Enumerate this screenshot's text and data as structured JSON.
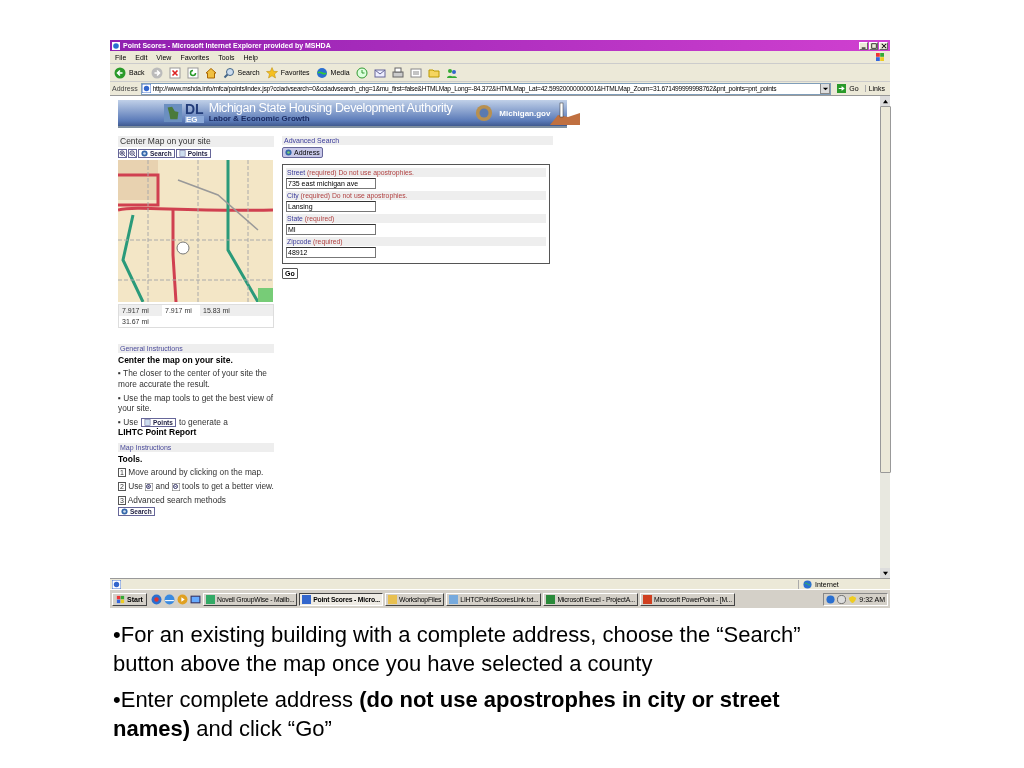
{
  "window": {
    "title": "Point Scores - Microsoft Internet Explorer provided by MSHDA"
  },
  "menu": [
    "File",
    "Edit",
    "View",
    "Favorites",
    "Tools",
    "Help"
  ],
  "toolbar": {
    "back": "Back",
    "search": "Search",
    "favorites": "Favorites",
    "media": "Media"
  },
  "address": {
    "label": "Address",
    "url": "http://www.mshda.info/mfca/points/index.jsp?cciadvsearch=0&cciadvsearch_chg=1&mu_first=false&HTMLMap_Long=-84.372&HTMLMap_Lat=42.59920000000001&HTMLMap_Zoom=31.671499999998762&pnt_points=pnt_points",
    "go": "Go",
    "links": "Links"
  },
  "banner": {
    "logo_top": "DL",
    "logo_bottom": "EG",
    "title": "Michigan State Housing Development Authority",
    "subtitle": "Labor & Economic Growth",
    "site": "Michigan.gov"
  },
  "map_panel": {
    "heading": "Center Map on your site",
    "search_button": "Search",
    "points_button": "Points",
    "scales": [
      "7.917 mi",
      "7.917 mi",
      "15.83 mi",
      "31.67 mi"
    ]
  },
  "general": {
    "heading": "General Instructions",
    "title": "Center the map on your site.",
    "bullets": [
      "▪ The closer to the center of your site the more accurate the result.",
      "▪ Use the map tools to get the best view of your site."
    ],
    "points_before": "▪ Use",
    "points_button": "Points",
    "points_after": "to generate a",
    "report": "LIHTC Point Report"
  },
  "map_instructions": {
    "heading": "Map Instructions",
    "title": "Tools.",
    "steps": [
      {
        "kind": "text",
        "number": "1",
        "text": "Move around by clicking on the map."
      },
      {
        "kind": "zoom",
        "number": "2",
        "before": "Use",
        "middle": "and",
        "after": "tools to get a better view."
      },
      {
        "kind": "search",
        "number": "3",
        "text": "Advanced search methods",
        "button": "Search"
      }
    ]
  },
  "search_panel": {
    "heading": "Advanced Search",
    "address_button": "Address",
    "go": "Go",
    "fields": [
      {
        "label": "Street",
        "note": "(required) Do not use apostrophies.",
        "value": "735 east michigan ave"
      },
      {
        "label": "City",
        "note": "(required) Do not use apostrophies.",
        "value": "Lansing"
      },
      {
        "label": "State",
        "note": "(required)",
        "value": "MI"
      },
      {
        "label": "Zipcode",
        "note": "(required)",
        "value": "48912"
      }
    ]
  },
  "status_bar": {
    "zone": "Internet"
  },
  "taskbar": {
    "start": "Start",
    "time": "9:32 AM",
    "tasks": [
      {
        "label": "Novell GroupWise - Mailb...",
        "selected": false
      },
      {
        "label": "Point Scores - Micro...",
        "selected": true
      },
      {
        "label": "WorkshopFiles",
        "selected": false
      },
      {
        "label": "LIHTCPointScoresLink.txt...",
        "selected": false
      },
      {
        "label": "Microsoft Excel - ProjectA...",
        "selected": false
      },
      {
        "label": "Microsoft PowerPoint - [M...",
        "selected": false
      }
    ]
  },
  "slide_bullets": [
    "•For an existing building with a complete address, choose the “Search” button above the map once you have selected a county",
    "•Enter complete address **(do not use apostrophes in city or street names)** and click “Go”"
  ]
}
